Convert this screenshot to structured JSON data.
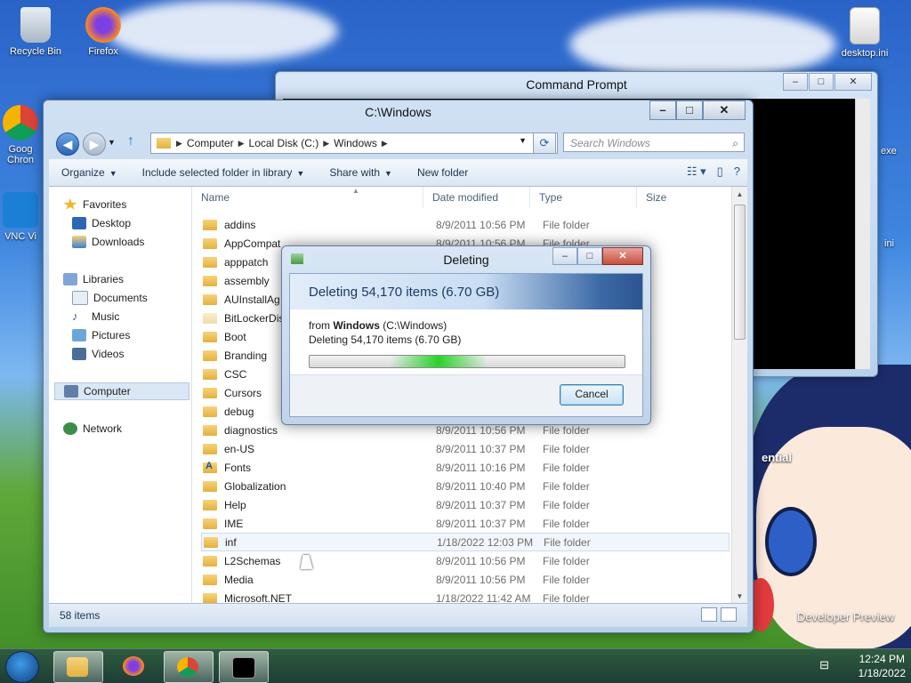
{
  "desktop": {
    "icons": [
      {
        "label": "Recycle Bin"
      },
      {
        "label": "Firefox"
      },
      {
        "label": "desktop.ini"
      }
    ],
    "partial_labels": [
      "Goog",
      "Chron",
      "VNC Vi",
      "exe",
      "ini",
      "ential",
      "Developer Preview"
    ]
  },
  "cmd": {
    "title": "Command Prompt"
  },
  "explorer": {
    "title": "C:\\Windows",
    "breadcrumb": [
      "Computer",
      "Local Disk (C:)",
      "Windows"
    ],
    "search_placeholder": "Search Windows",
    "toolbar": {
      "organize": "Organize",
      "include": "Include selected folder in library",
      "share": "Share with",
      "new_folder": "New folder"
    },
    "nav": {
      "favorites": "Favorites",
      "desktop": "Desktop",
      "downloads": "Downloads",
      "libraries": "Libraries",
      "documents": "Documents",
      "music": "Music",
      "pictures": "Pictures",
      "videos": "Videos",
      "computer": "Computer",
      "network": "Network"
    },
    "columns": {
      "name": "Name",
      "date": "Date modified",
      "type": "Type",
      "size": "Size"
    },
    "rows": [
      {
        "name": "addins",
        "date": "8/9/2011 10:56 PM",
        "type": "File folder"
      },
      {
        "name": "AppCompat",
        "date": "8/9/2011 10:56 PM",
        "type": "File folder"
      },
      {
        "name": "apppatch",
        "date": "",
        "type": ""
      },
      {
        "name": "assembly",
        "date": "",
        "type": ""
      },
      {
        "name": "AUInstallAg",
        "date": "",
        "type": ""
      },
      {
        "name": "BitLockerDis",
        "date": "",
        "type": ""
      },
      {
        "name": "Boot",
        "date": "",
        "type": ""
      },
      {
        "name": "Branding",
        "date": "",
        "type": ""
      },
      {
        "name": "CSC",
        "date": "",
        "type": ""
      },
      {
        "name": "Cursors",
        "date": "",
        "type": ""
      },
      {
        "name": "debug",
        "date": "",
        "type": ""
      },
      {
        "name": "diagnostics",
        "date": "8/9/2011 10:56 PM",
        "type": "File folder"
      },
      {
        "name": "en-US",
        "date": "8/9/2011 10:37 PM",
        "type": "File folder"
      },
      {
        "name": "Fonts",
        "date": "8/9/2011 10:16 PM",
        "type": "File folder"
      },
      {
        "name": "Globalization",
        "date": "8/9/2011 10:40 PM",
        "type": "File folder"
      },
      {
        "name": "Help",
        "date": "8/9/2011 10:37 PM",
        "type": "File folder"
      },
      {
        "name": "IME",
        "date": "8/9/2011 10:37 PM",
        "type": "File folder"
      },
      {
        "name": "inf",
        "date": "1/18/2022 12:03 PM",
        "type": "File folder"
      },
      {
        "name": "L2Schemas",
        "date": "8/9/2011 10:56 PM",
        "type": "File folder"
      },
      {
        "name": "Media",
        "date": "8/9/2011 10:56 PM",
        "type": "File folder"
      },
      {
        "name": "Microsoft.NET",
        "date": "1/18/2022 11:42 AM",
        "type": "File folder"
      }
    ],
    "status": "58 items"
  },
  "dialog": {
    "title": "Deleting",
    "heading": "Deleting 54,170 items (6.70 GB)",
    "from_prefix": "from",
    "from_bold": "Windows",
    "from_path": "(C:\\Windows)",
    "detail": "Deleting 54,170 items (6.70 GB)",
    "cancel": "Cancel"
  },
  "taskbar": {
    "time": "12:24 PM",
    "date": "1/18/2022"
  }
}
